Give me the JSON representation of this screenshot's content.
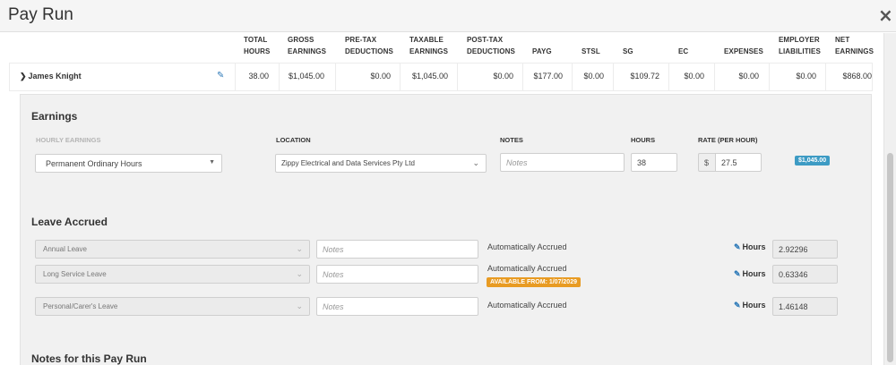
{
  "window": {
    "title": "Pay Run",
    "close_icon": "×"
  },
  "columns": {
    "total_hours": [
      "TOTAL",
      "HOURS"
    ],
    "gross_earnings": [
      "GROSS",
      "EARNINGS"
    ],
    "pre_tax": [
      "PRE-TAX",
      "DEDUCTIONS"
    ],
    "taxable": [
      "TAXABLE",
      "EARNINGS"
    ],
    "post_tax": [
      "POST-TAX",
      "DEDUCTIONS"
    ],
    "payg": "PAYG",
    "stsl": "STSL",
    "sg": "SG",
    "ec": "EC",
    "expenses": "EXPENSES",
    "employer": [
      "EMPLOYER",
      "LIABILITIES"
    ],
    "net": [
      "NET",
      "EARNINGS"
    ]
  },
  "employee": {
    "chevron_icon": "chevron-down-icon",
    "name": "James Knight",
    "total_hours": "38.00",
    "gross_earnings": "$1,045.00",
    "pre_tax": "$0.00",
    "taxable": "$1,045.00",
    "post_tax": "$0.00",
    "payg": "$177.00",
    "stsl": "$0.00",
    "sg": "$109.72",
    "ec": "$0.00",
    "expenses": "$0.00",
    "employer": "$0.00",
    "net": "$868.00"
  },
  "earnings": {
    "title": "Earnings",
    "labels": {
      "hourly": "HOURLY EARNINGS",
      "location": "LOCATION",
      "notes": "NOTES",
      "hours": "HOURS",
      "rate": "RATE (PER HOUR)"
    },
    "row": {
      "category": "Permanent Ordinary Hours",
      "location": "Zippy Electrical and Data Services Pty Ltd",
      "notes_placeholder": "Notes",
      "hours": "38",
      "rate_prefix": "$",
      "rate": "27.5",
      "total": "$1,045.00"
    }
  },
  "leave": {
    "title": "Leave Accrued",
    "rows": [
      {
        "type": "Annual Leave",
        "notes_placeholder": "Notes",
        "status": "Automatically Accrued",
        "badge": "",
        "hours_label": "Hours",
        "hours": "2.92296"
      },
      {
        "type": "Long Service Leave",
        "notes_placeholder": "Notes",
        "status": "Automatically Accrued",
        "badge": "AVAILABLE FROM: 1/07/2029",
        "hours_label": "Hours",
        "hours": "0.63346"
      },
      {
        "type": "Personal/Carer's Leave",
        "notes_placeholder": "Notes",
        "status": "Automatically Accrued",
        "badge": "",
        "hours_label": "Hours",
        "hours": "1.46148"
      }
    ]
  },
  "notes_section": {
    "title": "Notes for this Pay Run"
  },
  "colors": {
    "link_blue": "#2e7ab8",
    "badge_blue": "#3d9bc4",
    "badge_orange": "#e89b23"
  }
}
